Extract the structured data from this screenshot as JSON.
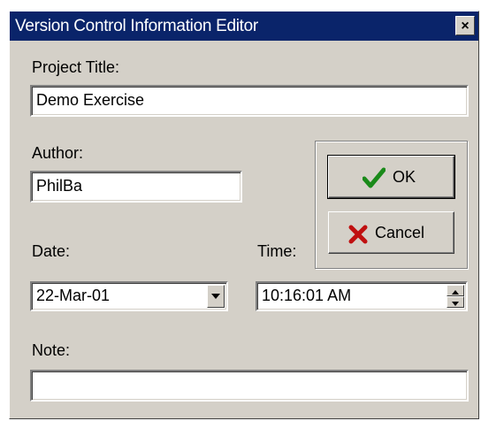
{
  "window": {
    "title": "Version Control Information Editor",
    "close_glyph": "×"
  },
  "fields": {
    "project_title": {
      "label": "Project Title:",
      "value": "Demo Exercise"
    },
    "author": {
      "label": "Author:",
      "value": "PhilBa"
    },
    "date": {
      "label": "Date:",
      "value": "22-Mar-01"
    },
    "time": {
      "label": "Time:",
      "value": "10:16:01 AM"
    },
    "note": {
      "label": "Note:",
      "value": ""
    }
  },
  "buttons": {
    "ok": {
      "label": "OK",
      "icon": "checkmark-icon",
      "color": "#1a8a1a"
    },
    "cancel": {
      "label": "Cancel",
      "icon": "x-icon",
      "color": "#c01010"
    }
  }
}
